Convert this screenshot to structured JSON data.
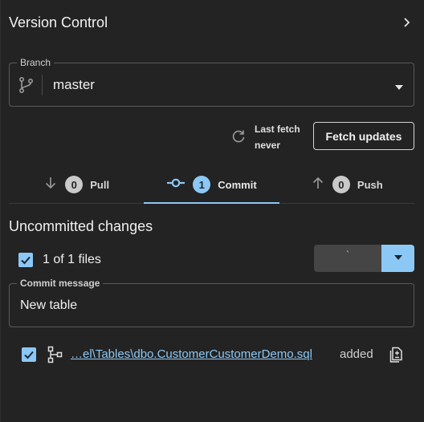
{
  "header": {
    "title": "Version Control",
    "expand_icon": "chevron-right-icon"
  },
  "branch": {
    "legend": "Branch",
    "value": "master",
    "icon": "git-branch-icon",
    "dropdown_icon": "caret-down-icon"
  },
  "fetch": {
    "icon": "refresh-icon",
    "last_fetch_label": "Last fetch",
    "last_fetch_value": "never",
    "button_label": "Fetch updates"
  },
  "tabs": [
    {
      "label": "Pull",
      "count": "0",
      "icon": "arrow-down-icon",
      "active": false
    },
    {
      "label": "Commit",
      "count": "1",
      "icon": "commit-icon",
      "active": true
    },
    {
      "label": "Push",
      "count": "0",
      "icon": "arrow-up-icon",
      "active": false
    }
  ],
  "changes": {
    "title": "Uncommitted changes",
    "files_summary": "1 of 1 files",
    "commit_button_label": "`",
    "commit_message_legend": "Commit message",
    "commit_message_value": "New table",
    "files": [
      {
        "path": "…el\\Tables\\dbo.CustomerCustomerDemo.sql",
        "status": "added",
        "checked": true,
        "icon": "table-tree-icon",
        "action_icon": "diff-document-icon"
      }
    ]
  },
  "colors": {
    "background": "#232323",
    "accent": "#8cc8f5",
    "border": "#5a5a5a",
    "disabled_button": "#454545"
  }
}
